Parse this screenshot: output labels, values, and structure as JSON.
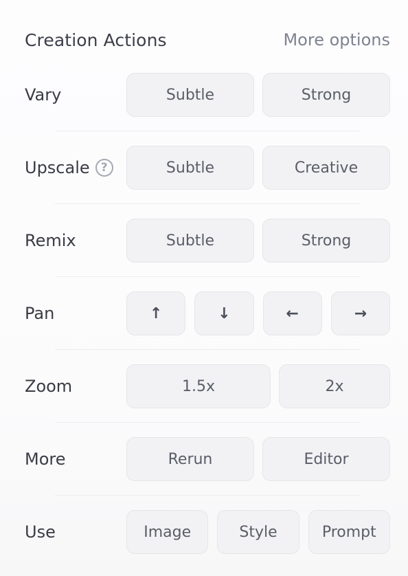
{
  "header": {
    "title": "Creation Actions",
    "more_options": "More options"
  },
  "rows": [
    {
      "label": "Vary",
      "buttons": [
        "Subtle",
        "Strong"
      ]
    },
    {
      "label": "Upscale",
      "buttons": [
        "Subtle",
        "Creative"
      ]
    },
    {
      "label": "Remix",
      "buttons": [
        "Subtle",
        "Strong"
      ]
    },
    {
      "label": "Pan",
      "buttons": [
        "↑",
        "↓",
        "←",
        "→"
      ]
    },
    {
      "label": "Zoom",
      "buttons": [
        "1.5x",
        "2x"
      ]
    },
    {
      "label": "More",
      "buttons": [
        "Rerun",
        "Editor"
      ]
    },
    {
      "label": "Use",
      "buttons": [
        "Image",
        "Style",
        "Prompt"
      ]
    }
  ],
  "icons": {
    "help": "question-mark-circle",
    "pan_up": "arrow-up",
    "pan_down": "arrow-down",
    "pan_left": "arrow-left",
    "pan_right": "arrow-right"
  },
  "help_glyph": "?"
}
